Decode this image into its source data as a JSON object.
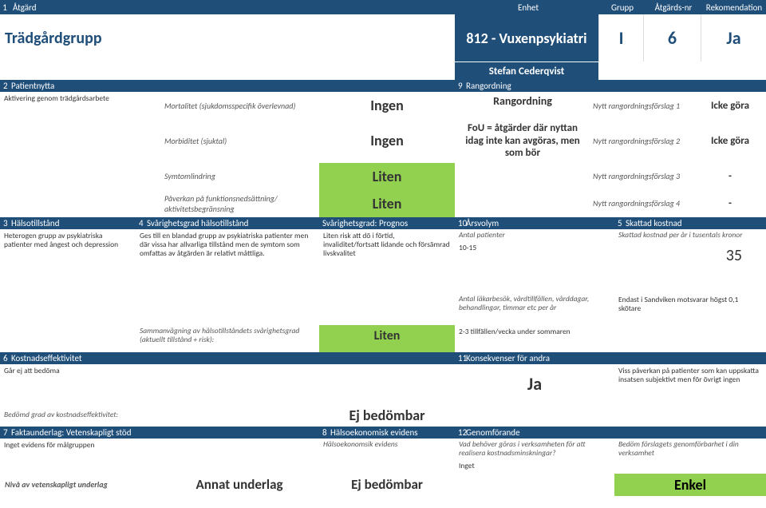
{
  "header": {
    "c1": "1",
    "c2": "Åtgärd",
    "c3": "Enhet",
    "c4": "Grupp",
    "c5": "Åtgärds-nr",
    "c6": "Rekomendation"
  },
  "title": {
    "name": "Trädgårdgrupp",
    "unit": "812 - Vuxenpsykiatri",
    "grupp": "I",
    "nr": "6",
    "rek": "Ja",
    "author": "Stefan Cederqvist"
  },
  "s2": {
    "hdr": "Patientnytta",
    "desc": "Aktivering genom trädgårdsarbete",
    "m1l": "Mortalitet (sjukdomsspecifik överlevnad)",
    "m1v": "Ingen",
    "m2l": "Morbiditet (sjuktal)",
    "m2v": "Ingen",
    "m3l": "Symtomlindring",
    "m3v": "Liten",
    "m4l": "Påverkan på funktionsnedsättning/ aktivitetsbegränsning",
    "m4v": "Liten"
  },
  "s9": {
    "hdr": "Rangordning",
    "big": "Rangordning",
    "r1l": "Nytt rangordningsförslag 1",
    "r1v": "Icke göra",
    "r2l": "Nytt rangordningsförslag 2",
    "r2v": "Icke göra",
    "r3l": "Nytt rangordningsförslag 3",
    "r3v": "-",
    "r4l": "Nytt rangordningsförslag 4",
    "r4v": "-",
    "fou": "FoU = åtgärder där nyttan idag inte kan avgöras, men som bör"
  },
  "s3": {
    "hdr": "Hälsotillstånd",
    "body": "Heterogen grupp av psykiatriska patienter med ångest och depression"
  },
  "s4": {
    "hdr": "Svårighetsgrad hälsotillstånd",
    "body": "Ges till en blandad grupp av psykiatriska patienter men där vissa har allvarliga tillstånd men de symtom som omfattas av åtgärden är relativt måttliga.",
    "summary_lbl": "Sammanvägning av hälsotillståndets svårighetsgrad (aktuellt tillstånd + risk):",
    "summary_val": "Liten"
  },
  "sP": {
    "hdr": "Svårighetsgrad: Prognos",
    "body": "Liten risk att dö i förtid, invaliditet/fortsatt lidande och försämrad livskvalitet"
  },
  "s10": {
    "hdr": "Årsvolym",
    "l1": "Antal patienter",
    "v1": "10-15",
    "l2": "Antal läkarbesök, vårdtillfällen, vårddagar, behandlingar, timmar etc per år",
    "v2": "2-3 tillfällen/vecka under sommaren"
  },
  "s5": {
    "hdr": "Skattad kostnad",
    "l1": "Skattad kostnad per år i tusentals kronor",
    "v1": "35",
    "note": "Endast i Sandviken motsvarar högst 0,1 skötare"
  },
  "s6": {
    "hdr": "Kostnadseffektivitet",
    "body": "Går ej att bedöma",
    "lbl": "Bedömd grad av kostnadseffektivitet:",
    "val": "Ej bedömbar"
  },
  "s11": {
    "hdr": "Konsekvenser för andra",
    "val": "Ja",
    "note": "Viss påverkan på patienter som kan uppskatta insatsen subjektivt men för övrigt ingen"
  },
  "s7": {
    "hdr": "Faktaunderlag: Vetenskapligt stöd",
    "body": "Inget evidens för målgruppen",
    "lbl": "Nivå av vetenskapligt underlag",
    "val": "Annat underlag"
  },
  "s8": {
    "hdr": "Hälsoekonomisk evidens",
    "body": "Hälsoekonomsik evidens",
    "val": "Ej bedömbar"
  },
  "s12": {
    "hdr": "Genomförande",
    "q": "Vad behöver göras i verksamheten för att realisera kostnadsminskningar?",
    "a": "Inget",
    "lbl": "Bedöm förslagets genomförbarhet i din verksamhet",
    "val": "Enkel"
  }
}
